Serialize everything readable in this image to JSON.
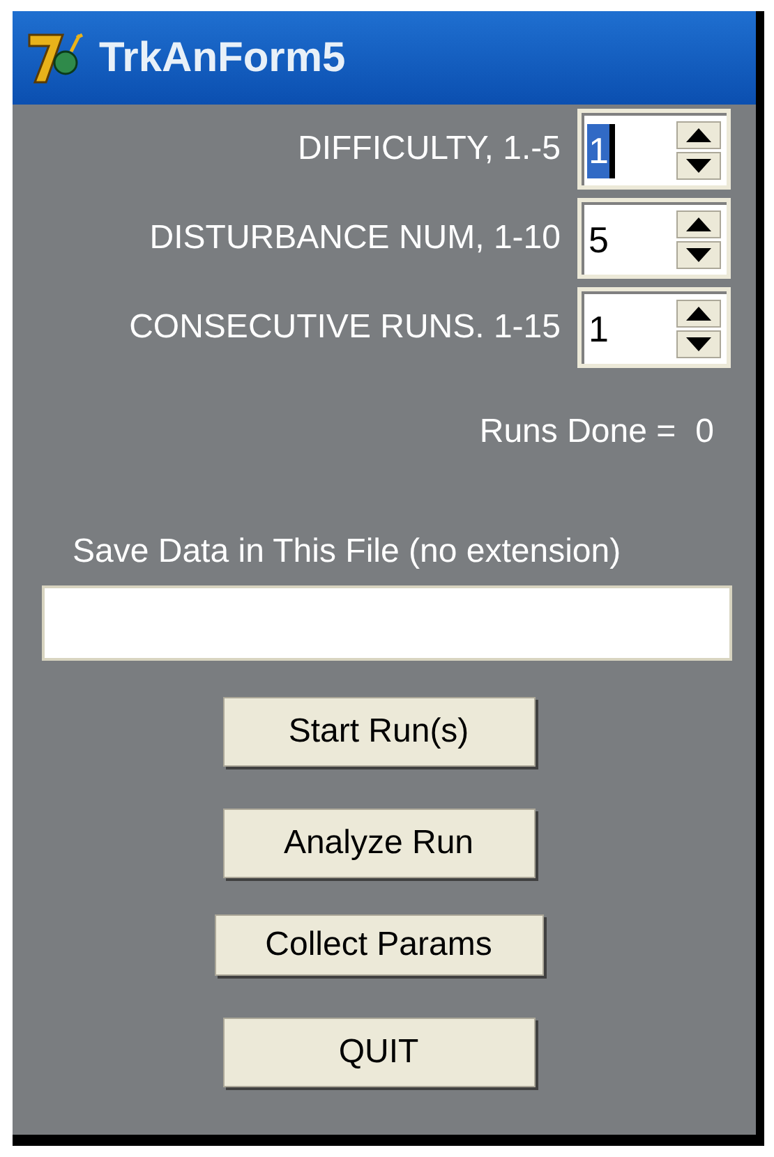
{
  "window": {
    "title": "TrkAnForm5"
  },
  "spinners": [
    {
      "label": "DIFFICULTY, 1.-5",
      "value": "1",
      "selected": true
    },
    {
      "label": "DISTURBANCE NUM, 1-10",
      "value": "5",
      "selected": false
    },
    {
      "label": "CONSECUTIVE RUNS. 1-15",
      "value": "1",
      "selected": false
    }
  ],
  "runs_done": {
    "label": "Runs Done =",
    "value": "0"
  },
  "save_file": {
    "label": "Save Data in This File  (no extension)"
  },
  "buttons": [
    {
      "label": "Start Run(s)",
      "kind": "normal"
    },
    {
      "label": "Analyze Run",
      "kind": "normal"
    },
    {
      "label": "Collect Params",
      "kind": "wide"
    },
    {
      "label": "QUIT",
      "kind": "normal"
    }
  ]
}
